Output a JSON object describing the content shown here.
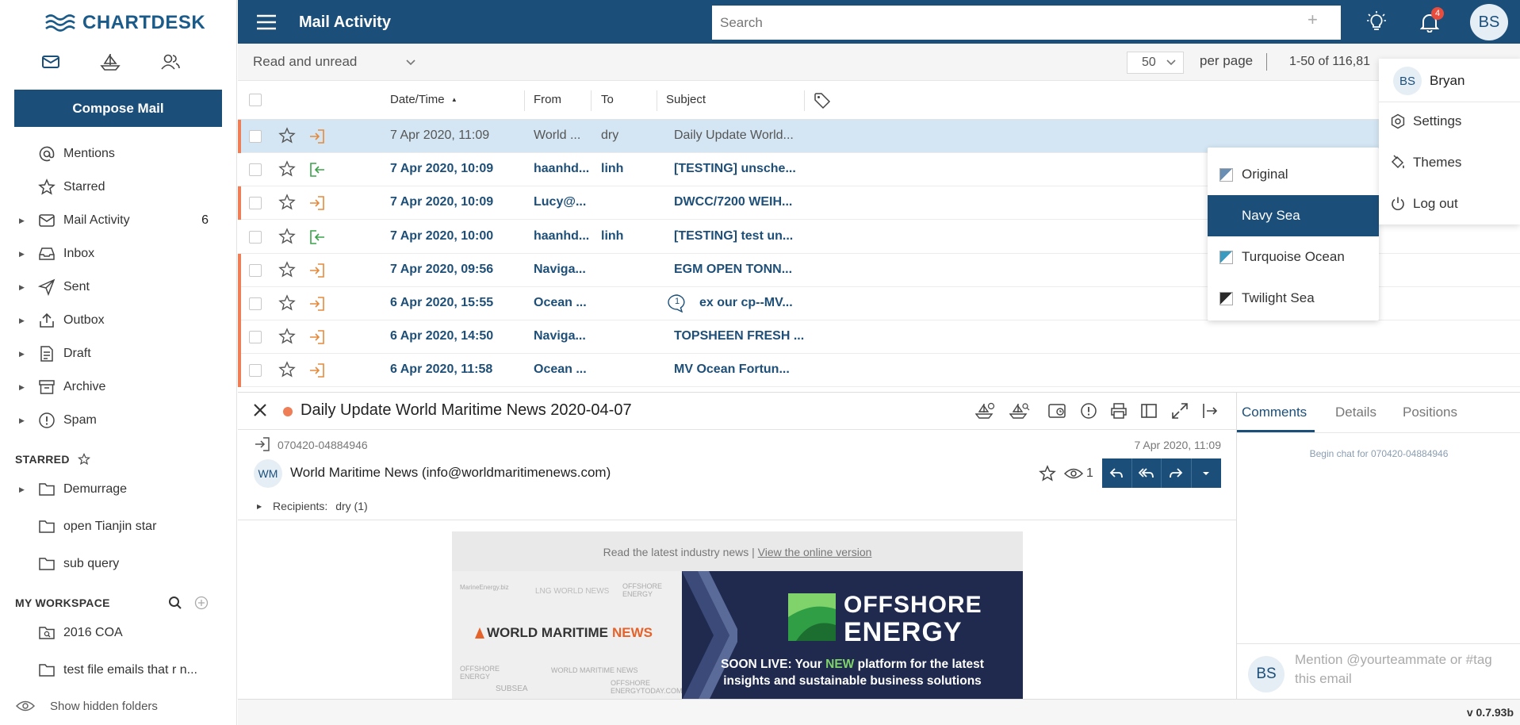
{
  "brand": {
    "name": "CHARTDESK"
  },
  "sidebar": {
    "compose_label": "Compose Mail",
    "items": [
      {
        "label": "Mentions",
        "icon": "at-icon",
        "count": ""
      },
      {
        "label": "Starred",
        "icon": "star-icon",
        "count": ""
      },
      {
        "label": "Mail Activity",
        "icon": "mail-icon",
        "count": "6"
      },
      {
        "label": "Inbox",
        "icon": "inbox-icon",
        "count": ""
      },
      {
        "label": "Sent",
        "icon": "send-icon",
        "count": ""
      },
      {
        "label": "Outbox",
        "icon": "upload-icon",
        "count": ""
      },
      {
        "label": "Draft",
        "icon": "draft-icon",
        "count": ""
      },
      {
        "label": "Archive",
        "icon": "archive-icon",
        "count": ""
      },
      {
        "label": "Spam",
        "icon": "alert-icon",
        "count": ""
      }
    ],
    "starred_header": "STARRED",
    "starred": [
      {
        "label": "Demurrage"
      },
      {
        "label": "open Tianjin star"
      },
      {
        "label": "sub query"
      }
    ],
    "workspace_header": "MY WORKSPACE",
    "workspace": [
      {
        "label": "2016 COA"
      },
      {
        "label": "test file emails that r n..."
      }
    ],
    "show_hidden": "Show hidden folders"
  },
  "topbar": {
    "title": "Mail Activity",
    "search_placeholder": "Search",
    "notif_count": "4",
    "avatar_initials": "BS",
    "accent": "#1b4f7a"
  },
  "filter": {
    "read_filter": "Read and unread",
    "per_page_value": "50",
    "per_page_label": "per page",
    "range": "1-50 of 116,81"
  },
  "table": {
    "headers": {
      "date": "Date/Time",
      "from": "From",
      "to": "To",
      "subject": "Subject"
    },
    "rows": [
      {
        "date": "7 Apr 2020, 11:09",
        "from": "World ...",
        "to": "dry",
        "subject": "Daily Update World...",
        "direction": "in",
        "unread": false,
        "selected": true,
        "comment": ""
      },
      {
        "date": "7 Apr 2020, 10:09",
        "from": "haanhd...",
        "to": "linh",
        "subject": "[TESTING] unsche...",
        "direction": "out",
        "unread": true,
        "selected": false,
        "comment": ""
      },
      {
        "date": "7 Apr 2020, 10:09",
        "from": "Lucy@...",
        "to": "",
        "subject": "DWCC/7200 WEIH...",
        "direction": "in",
        "unread": true,
        "selected": false,
        "comment": ""
      },
      {
        "date": "7 Apr 2020, 10:00",
        "from": "haanhd...",
        "to": "linh",
        "subject": "[TESTING] test un...",
        "direction": "out",
        "unread": true,
        "selected": false,
        "comment": ""
      },
      {
        "date": "7 Apr 2020, 09:56",
        "from": "Naviga...",
        "to": "",
        "subject": "EGM OPEN TONN...",
        "direction": "in",
        "unread": true,
        "selected": false,
        "comment": ""
      },
      {
        "date": "6 Apr 2020, 15:55",
        "from": "Ocean ...",
        "to": "",
        "subject": "ex our cp--MV...",
        "direction": "in",
        "unread": true,
        "selected": false,
        "comment": "1"
      },
      {
        "date": "6 Apr 2020, 14:50",
        "from": "Naviga...",
        "to": "",
        "subject": "TOPSHEEN FRESH ...",
        "direction": "in",
        "unread": true,
        "selected": false,
        "comment": ""
      },
      {
        "date": "6 Apr 2020, 11:58",
        "from": "Ocean ...",
        "to": "",
        "subject": "MV Ocean Fortun...",
        "direction": "in",
        "unread": true,
        "selected": false,
        "comment": ""
      }
    ]
  },
  "themes": {
    "items": [
      {
        "label": "Original",
        "color": "#6a8fb5"
      },
      {
        "label": "Navy Sea",
        "color": "#1b4f7a"
      },
      {
        "label": "Turquoise Ocean",
        "color": "#3a9bc1"
      },
      {
        "label": "Twilight Sea",
        "color": "#2b2b2b"
      }
    ],
    "active": "Navy Sea"
  },
  "user_menu": {
    "initials": "BS",
    "name": "Bryan",
    "items": [
      {
        "label": "Settings"
      },
      {
        "label": "Themes"
      },
      {
        "label": "Log out"
      }
    ]
  },
  "preview": {
    "title": "Daily Update World Maritime News 2020-04-07",
    "id": "070420-04884946",
    "date": "7 Apr 2020, 11:09",
    "sender_initials": "WM",
    "sender": "World Maritime News (info@worldmaritimenews.com)",
    "views": "1",
    "recipients_label": "Recipients:",
    "recipients": "dry (1)",
    "newsletter": {
      "top_text": "Read the latest industry news |",
      "top_link": "View the online version",
      "brand_world": "WORLD MARITIME",
      "brand_news": "NEWS",
      "small_logos": [
        "MarineEnergy.biz",
        "LNG WORLD NEWS",
        "OFFSHORE ENERGY",
        "OFFSHORE ENERGY",
        "WORLD MARITIME NEWS",
        "SUBSEA",
        "OFFSHORE ENERGYTODAY.COM"
      ],
      "right_title_1": "OFFSHORE",
      "right_title_2": "ENERGY",
      "soon_1": "SOON LIVE: Your",
      "soon_new": "NEW",
      "soon_2": "platform for the latest",
      "soon_3": "insights and sustainable business solutions"
    }
  },
  "rpanel": {
    "tabs": [
      "Comments",
      "Details",
      "Positions"
    ],
    "chat_text": "Begin chat for 070420-04884946",
    "avatar": "BS",
    "placeholder": "Mention @yourteammate or #tag this email"
  },
  "version": "v 0.7.93b"
}
